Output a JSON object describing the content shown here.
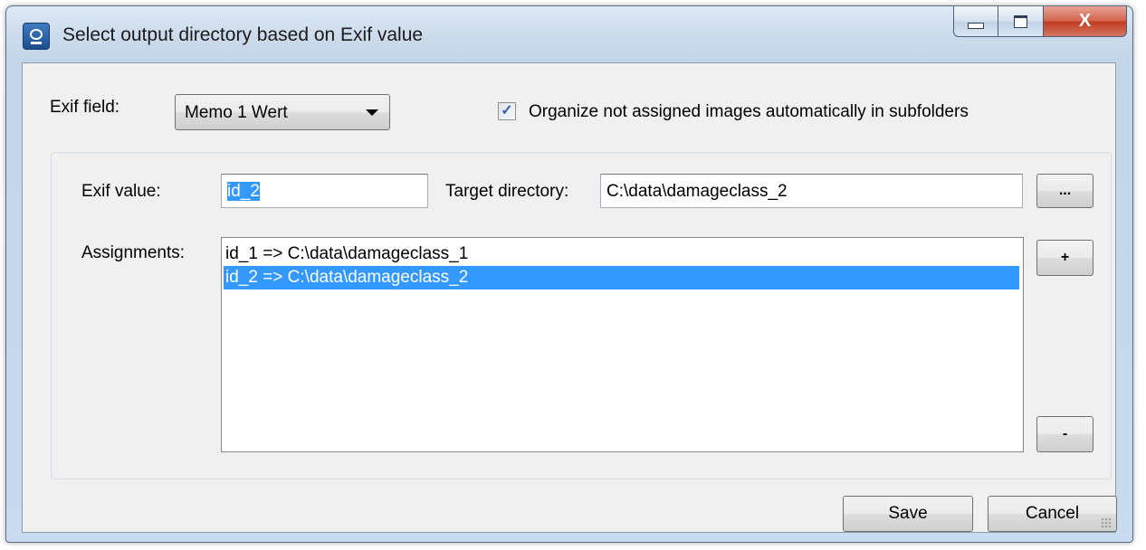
{
  "window": {
    "title": "Select output directory based on Exif value",
    "icon": "camera-icon",
    "caption": {
      "minimize_icon": "minimize-icon",
      "maximize_icon": "maximize-icon",
      "close_glyph": "X"
    }
  },
  "exif_field": {
    "label": "Exif field:",
    "selected": "Memo 1 Wert"
  },
  "organize_option": {
    "label": "Organize not assigned images automatically in subfolders",
    "checked": true,
    "check_glyph": "✓"
  },
  "exif_value": {
    "label": "Exif value:",
    "value": "id_2"
  },
  "target_directory": {
    "label": "Target directory:",
    "value": "C:\\data\\damageclass_2",
    "browse_label": "..."
  },
  "assignments": {
    "label": "Assignments:",
    "items": [
      "id_1 => C:\\data\\damageclass_1",
      "id_2 => C:\\data\\damageclass_2"
    ],
    "selected_index": 1,
    "add_label": "+",
    "remove_label": "-"
  },
  "footer": {
    "save_label": "Save",
    "cancel_label": "Cancel"
  },
  "colors": {
    "selection": "#3399ff",
    "close_button": "#c13a20",
    "window_frame": "#c3d5e9"
  }
}
